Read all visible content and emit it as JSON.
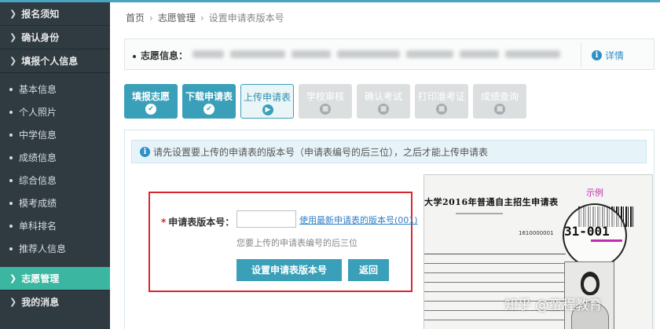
{
  "sidebar": {
    "sections": [
      {
        "label": "报名须知"
      },
      {
        "label": "确认身份"
      },
      {
        "label": "填报个人信息"
      }
    ],
    "sub_items": [
      {
        "label": "基本信息"
      },
      {
        "label": "个人照片"
      },
      {
        "label": "中学信息"
      },
      {
        "label": "成绩信息"
      },
      {
        "label": "综合信息"
      },
      {
        "label": "模考成绩"
      },
      {
        "label": "单科排名"
      },
      {
        "label": "推荐人信息"
      }
    ],
    "active": {
      "label": "志愿管理"
    },
    "last": {
      "label": "我的消息"
    }
  },
  "breadcrumb": {
    "home": "首页",
    "section": "志愿管理",
    "current": "设置申请表版本号"
  },
  "info": {
    "label": "志愿信息：",
    "detail": "详情"
  },
  "steps": [
    {
      "label": "填报志愿",
      "state": "done"
    },
    {
      "label": "下载申请表",
      "state": "done"
    },
    {
      "label": "上传申请表",
      "state": "current"
    },
    {
      "label": "学校审核",
      "state": "todo"
    },
    {
      "label": "确认考试",
      "state": "todo"
    },
    {
      "label": "打印准考证",
      "state": "todo"
    },
    {
      "label": "成绩查询",
      "state": "todo"
    }
  ],
  "notice": "请先设置要上传的申请表的版本号（申请表编号的后三位），之后才能上传申请表",
  "form": {
    "label": "申请表版本号：",
    "input_value": "",
    "latest_link": "使用最新申请表的版本号(001)",
    "hint": "您要上传的申请表编号的后三位",
    "set_button": "设置申请表版本号",
    "back_button": "返回"
  },
  "sample": {
    "title": "大学2016年普通自主招生申请表",
    "tag": "示例",
    "code": "31-001",
    "digits": "1610000001"
  },
  "watermark": "知乎 @蛮程教育",
  "colors": {
    "accent": "#3a9fb8",
    "sidebar_bg": "#2f3a41",
    "active_bg": "#3ab6a1",
    "highlight_border": "#d9262c"
  }
}
